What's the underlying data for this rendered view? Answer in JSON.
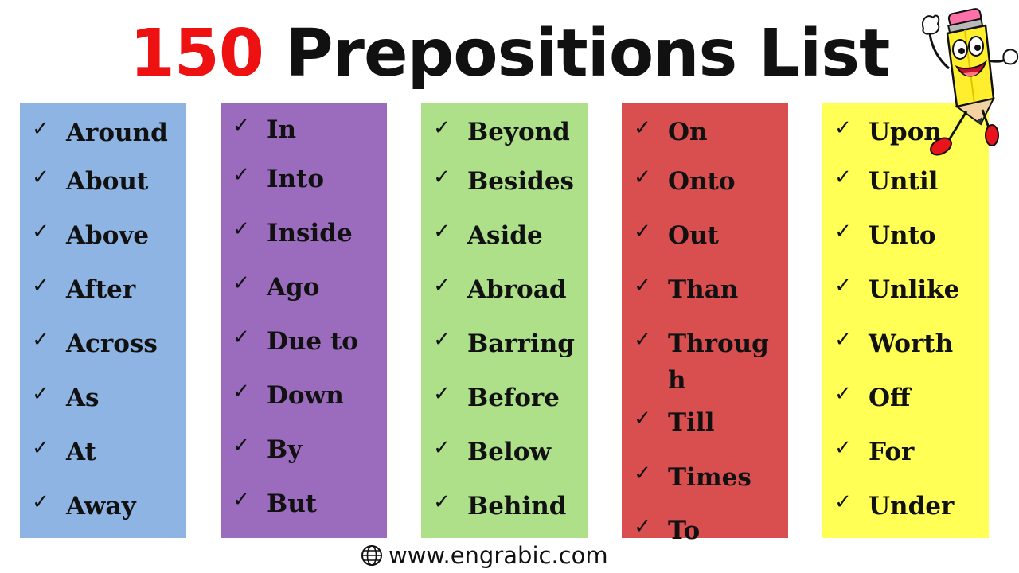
{
  "title": {
    "number": "150",
    "text": "Prepositions List"
  },
  "colors": {
    "title_number": "#ee1111",
    "title_text": "#111111",
    "column_1": "#8db4e2",
    "column_2": "#9b6bbd",
    "column_3": "#aee08a",
    "column_4": "#d94f50",
    "column_5": "#ffff55"
  },
  "check_glyph": "✓",
  "columns": [
    {
      "words": [
        "Around",
        "About",
        "Above",
        "After",
        "Across",
        "As",
        "At",
        "Away"
      ]
    },
    {
      "words": [
        "In",
        "Into",
        "Inside",
        "Ago",
        "Due to",
        "Down",
        "By",
        "But"
      ]
    },
    {
      "words": [
        "Beyond",
        "Besides",
        "Aside",
        "Abroad",
        "Barring",
        "Before",
        "Below",
        "Behind"
      ]
    },
    {
      "words": [
        "On",
        "Onto",
        "Out",
        "Than",
        "Through",
        "Till",
        "Times",
        "To"
      ]
    },
    {
      "words": [
        "Upon",
        "Until",
        "Unto",
        "Unlike",
        "Worth",
        "Off",
        "For",
        "Under"
      ]
    }
  ],
  "mascot": {
    "icon": "pencil-mascot-icon"
  },
  "footer": {
    "icon": "globe-icon",
    "url": "www.engrabic.com"
  }
}
